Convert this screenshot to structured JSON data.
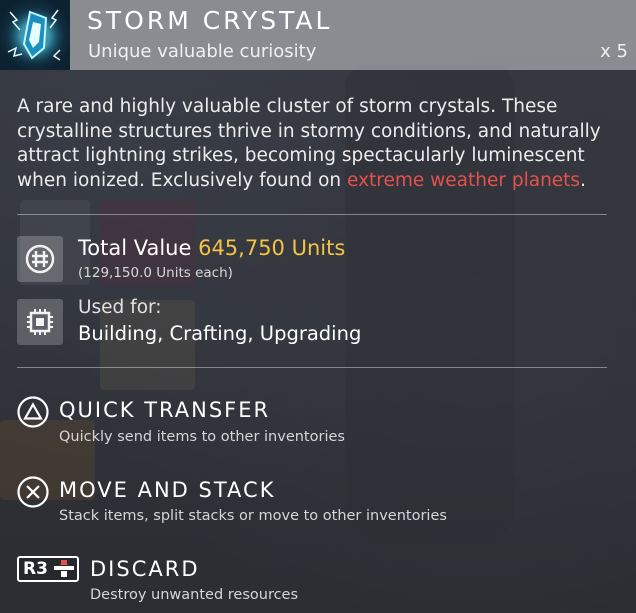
{
  "item": {
    "name": "STORM CRYSTAL",
    "subtitle": "Unique valuable curiosity",
    "quantity": "x 5",
    "icon": "storm-crystal-icon"
  },
  "description": {
    "text": "A rare and highly valuable cluster of storm crystals. These crystalline structures thrive in stormy conditions, and naturally attract lightning strikes, becoming spectacularly luminescent when ionized. Exclusively found on ",
    "highlight": "extreme weather planets",
    "end": "."
  },
  "value": {
    "label": "Total Value",
    "amount": "645,750 Units",
    "each": "(129,150.0 Units each)",
    "icon": "units-icon"
  },
  "usage": {
    "label": "Used for:",
    "value": "Building, Crafting, Upgrading",
    "icon": "chip-icon"
  },
  "actions": [
    {
      "title": "QUICK TRANSFER",
      "desc": "Quickly send items to other inventories",
      "icon": "triangle-button-icon"
    },
    {
      "title": "MOVE AND STACK",
      "desc": "Stack items, split stacks or move to other inventories",
      "icon": "cross-button-icon"
    },
    {
      "title": "DISCARD",
      "desc": "Destroy unwanted resources",
      "icon": "r3-button-icon",
      "button": "R3"
    }
  ],
  "colors": {
    "accent_red": "#e7504c",
    "value_gold": "#f5c342"
  }
}
